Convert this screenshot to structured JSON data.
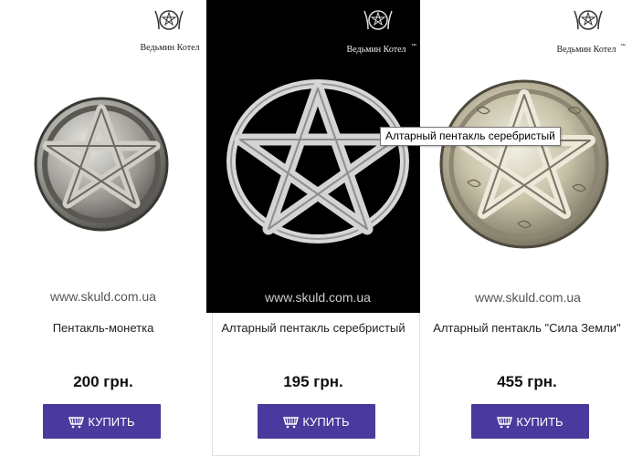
{
  "brand": {
    "logo_text": "Ведьмин Котел",
    "trademark": "™"
  },
  "watermark": "www.skuld.com.ua",
  "products": [
    {
      "name": "Пентакль-монетка",
      "price": "200 грн.",
      "buy_label": "КУПИТЬ",
      "photo_bg": "#ffffff"
    },
    {
      "name": "Алтарный пентакль серебристый",
      "price": "195 грн.",
      "buy_label": "КУПИТЬ",
      "photo_bg": "#000000"
    },
    {
      "name": "Алтарный пентакль \"Сила Земли\"",
      "price": "455 грн.",
      "buy_label": "КУПИТЬ",
      "photo_bg": "#ffffff"
    }
  ],
  "tooltip": "Алтарный пентакль серебристый",
  "colors": {
    "button": "#4a3a9e",
    "button_text": "#ffffff"
  }
}
